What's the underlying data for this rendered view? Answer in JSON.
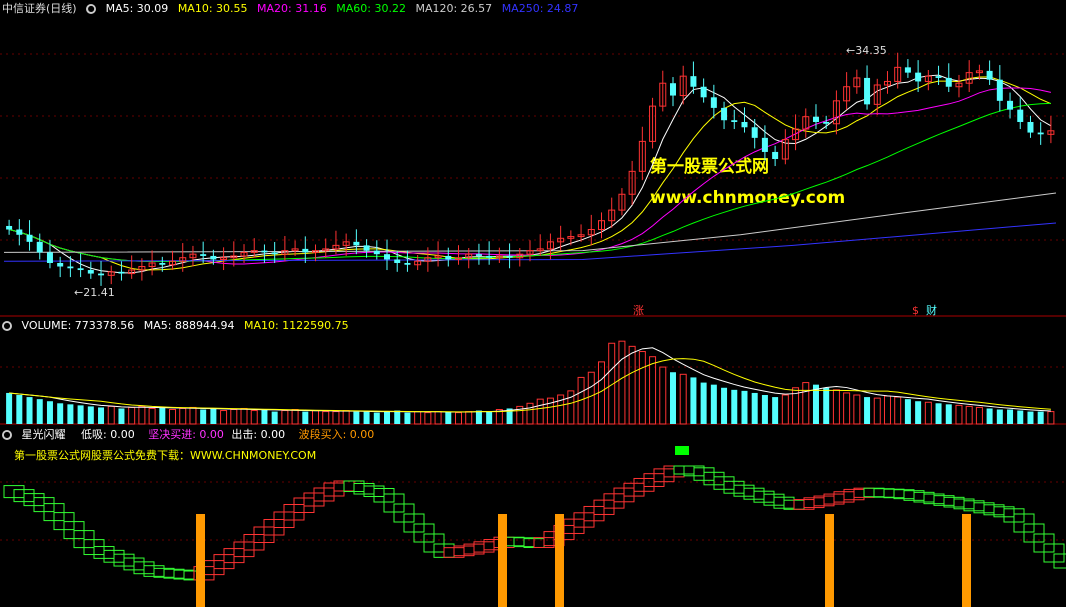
{
  "header": {
    "stock": "中信证券",
    "period": "(日线)",
    "ma5": "MA5: 30.09",
    "ma10": "MA10: 30.55",
    "ma20": "MA20: 31.16",
    "ma60": "MA60: 30.22",
    "ma120": "MA120: 26.57",
    "ma250": "MA250: 24.87"
  },
  "price_panel": {
    "high_label": "34.35",
    "low_label": "21.41",
    "marker_zhang": "涨",
    "marker_s": "$",
    "marker_cai": "财",
    "watermark_title": "第一股票公式网",
    "watermark_url": "www.chnmoney.com"
  },
  "volume_header": {
    "volume": "VOLUME: 773378.56",
    "ma5": "MA5: 888944.94",
    "ma10": "MA10: 1122590.75"
  },
  "indicator_header": {
    "name": "星光闪耀",
    "dixi": "低吸: 0.00",
    "jianjue": "坚决买进: 0.00",
    "chuji": "出击: 0.00",
    "boduan": "波段买入: 0.00"
  },
  "indicator_note": "第一股票公式网股票公式免费下载：WWW.CHNMONEY.COM",
  "colors": {
    "up": "#ff3333",
    "down": "#54ffff",
    "ma5": "#ffffff",
    "ma10": "#ffff00",
    "ma20": "#ff00ff",
    "ma60": "#00ff00",
    "ma120": "#cccccc",
    "ma250": "#3333ff",
    "signal": "#ff9900",
    "box_up": "#ff3333",
    "box_down": "#33ff33"
  },
  "chart_data": [
    {
      "type": "candlestick",
      "title": "中信证券 (日线)",
      "ylim": [
        20.5,
        36.5
      ],
      "low_annotation": 21.41,
      "high_annotation": 34.35,
      "close": [
        24.5,
        24.2,
        23.8,
        23.2,
        22.6,
        22.4,
        22.3,
        22.2,
        22.0,
        21.9,
        22.1,
        22.0,
        22.2,
        22.4,
        22.6,
        22.5,
        22.7,
        22.9,
        23.1,
        23.0,
        22.8,
        22.9,
        23.0,
        23.2,
        23.3,
        23.2,
        23.1,
        23.3,
        23.4,
        23.2,
        23.3,
        23.4,
        23.6,
        23.8,
        23.6,
        23.3,
        23.1,
        22.8,
        22.6,
        22.5,
        22.7,
        22.9,
        23.0,
        22.8,
        22.9,
        23.1,
        23.0,
        22.9,
        23.0,
        22.9,
        23.1,
        23.3,
        23.4,
        23.8,
        24.0,
        24.1,
        24.2,
        24.5,
        25.0,
        25.6,
        26.5,
        27.8,
        29.5,
        31.5,
        32.8,
        32.1,
        33.2,
        32.6,
        32.0,
        31.4,
        30.7,
        30.6,
        30.3,
        29.7,
        28.9,
        28.5,
        29.6,
        30.2,
        30.9,
        30.6,
        30.5,
        31.8,
        32.6,
        33.1,
        31.6,
        32.7,
        32.9,
        33.7,
        33.4,
        32.9,
        33.2,
        33.1,
        32.6,
        32.8,
        33.4,
        33.5,
        33.0,
        31.8,
        31.3,
        30.6,
        30.0,
        29.9,
        30.1
      ],
      "ma_lines": [
        "MA5",
        "MA10",
        "MA20",
        "MA60",
        "MA120",
        "MA250"
      ],
      "ma_values_last": {
        "MA5": 30.09,
        "MA10": 30.55,
        "MA20": 31.16,
        "MA60": 30.22,
        "MA120": 26.57,
        "MA250": 24.87
      }
    },
    {
      "type": "bar",
      "title": "VOLUME",
      "values": [
        30,
        28,
        26,
        24,
        22,
        20,
        19,
        18,
        17,
        16,
        17,
        15,
        16,
        17,
        15,
        16,
        14,
        15,
        16,
        14,
        15,
        13,
        14,
        15,
        13,
        14,
        12,
        13,
        14,
        12,
        13,
        12,
        12,
        13,
        12,
        12,
        11,
        12,
        13,
        11,
        12,
        11,
        12,
        12,
        11,
        12,
        13,
        12,
        14,
        15,
        17,
        20,
        24,
        25,
        28,
        32,
        45,
        50,
        60,
        78,
        80,
        75,
        70,
        65,
        55,
        50,
        48,
        45,
        40,
        38,
        35,
        33,
        32,
        30,
        28,
        26,
        28,
        35,
        40,
        38,
        35,
        33,
        30,
        28,
        26,
        25,
        27,
        26,
        24,
        22,
        21,
        20,
        19,
        18,
        17,
        16,
        15,
        14,
        14,
        13,
        12,
        12,
        12
      ],
      "last": 773378.56,
      "ma5": 888944.94,
      "ma10": 1122590.75
    },
    {
      "type": "line",
      "title": "星光闪耀",
      "series": [
        {
          "name": "低吸",
          "last": 0.0
        },
        {
          "name": "坚决买进",
          "last": 0.0
        },
        {
          "name": "出击",
          "last": 0.0
        },
        {
          "name": "波段买入",
          "last": 0.0
        }
      ]
    }
  ]
}
